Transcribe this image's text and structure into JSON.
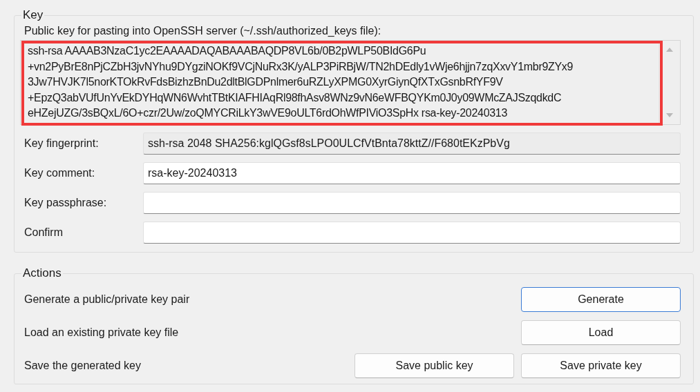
{
  "key_group": {
    "title": "Key",
    "public_key_label": "Public key for pasting into OpenSSH server (~/.ssh/authorized_keys file):",
    "highlighted": true,
    "public_key_lines": [
      "ssh-rsa AAAAB3NzaC1yc2EAAAADAQABAAABAQDP8VL6b/0B2pWLP50BIdG6Pu",
      "+vn2PyBrE8nPjCZbH3jvNYhu9DYgziNOKf9VCjNuRx3K/yALP3PiRBjW/TN2hDEdly1vWje6hjjn7zqXxvY1mbr9ZYx9",
      "3Jw7HVJK7l5norKTOkRvFdsBizhzBnDu2dltBlGDPnlmer6uRZLyXPMG0XyrGiynQfXTxGsnbRfYF9V",
      "+EpzQ3abVUfUnYvEkDYHqWN6WvhtTBtKIAFHIAqRl98fhAsv8WNz9vN6eWFBQYKm0J0y09WMcZAJSzqdkdC",
      "eHZejUZG/3sBQxL/6O+czr/2Uw/zoQMYCRiLkY3wVE9oULT6rdOhWfPIViO3SpHx rsa-key-20240313"
    ],
    "fields": [
      {
        "label": "Key fingerprint:",
        "value": "ssh-rsa 2048 SHA256:kglQGsf8sLPO0ULCfVtBnta78kttZ//F680tEKzPbVg",
        "readonly": true
      },
      {
        "label": "Key comment:",
        "value": "rsa-key-20240313",
        "readonly": false
      },
      {
        "label": "Key passphrase:",
        "readonly": false
      },
      {
        "label": "Confirm",
        "readonly": false
      }
    ]
  },
  "actions_group": {
    "title": "Actions",
    "rows": [
      {
        "text": "Generate a public/private key pair",
        "buttons": [
          {
            "label": "Generate",
            "focused": true
          }
        ]
      },
      {
        "text": "Load an existing private key file",
        "buttons": [
          {
            "label": "Load",
            "focused": false
          }
        ]
      },
      {
        "text": "Save the generated key",
        "buttons": [
          {
            "label": "Save public key",
            "focused": false
          },
          {
            "label": "Save private key",
            "focused": false
          }
        ]
      }
    ]
  }
}
